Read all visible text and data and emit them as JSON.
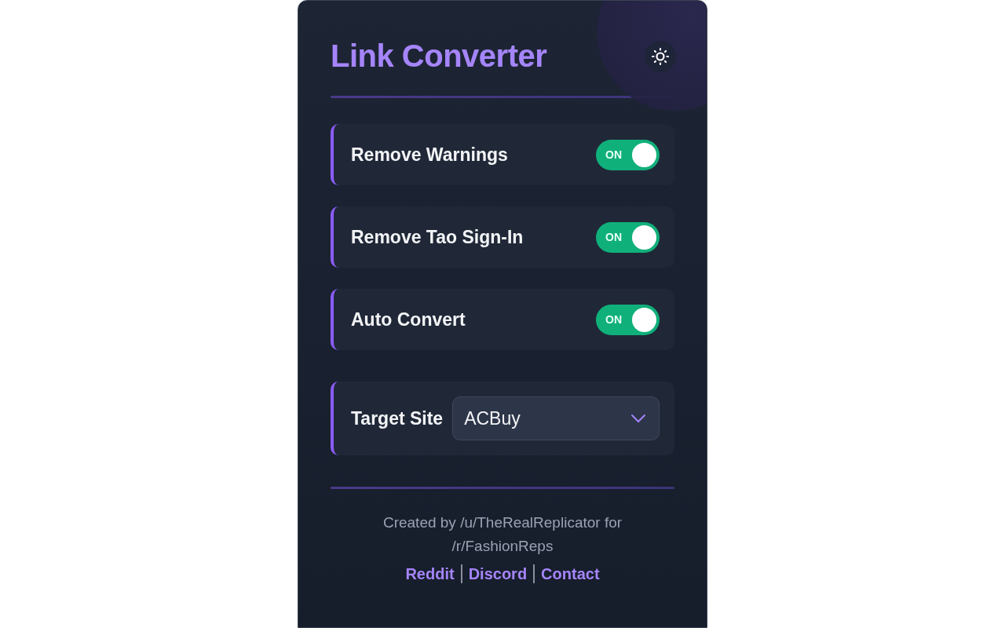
{
  "header": {
    "title": "Link Converter"
  },
  "settings": [
    {
      "label": "Remove Warnings",
      "on": true,
      "state_text": "ON"
    },
    {
      "label": "Remove Tao Sign-In",
      "on": true,
      "state_text": "ON"
    },
    {
      "label": "Auto Convert",
      "on": true,
      "state_text": "ON"
    }
  ],
  "target_site": {
    "label": "Target Site",
    "value": "ACBuy"
  },
  "footer": {
    "credit": "Created by /u/TheRealReplicator for /r/FashionReps",
    "links": [
      "Reddit",
      "Discord",
      "Contact"
    ]
  }
}
